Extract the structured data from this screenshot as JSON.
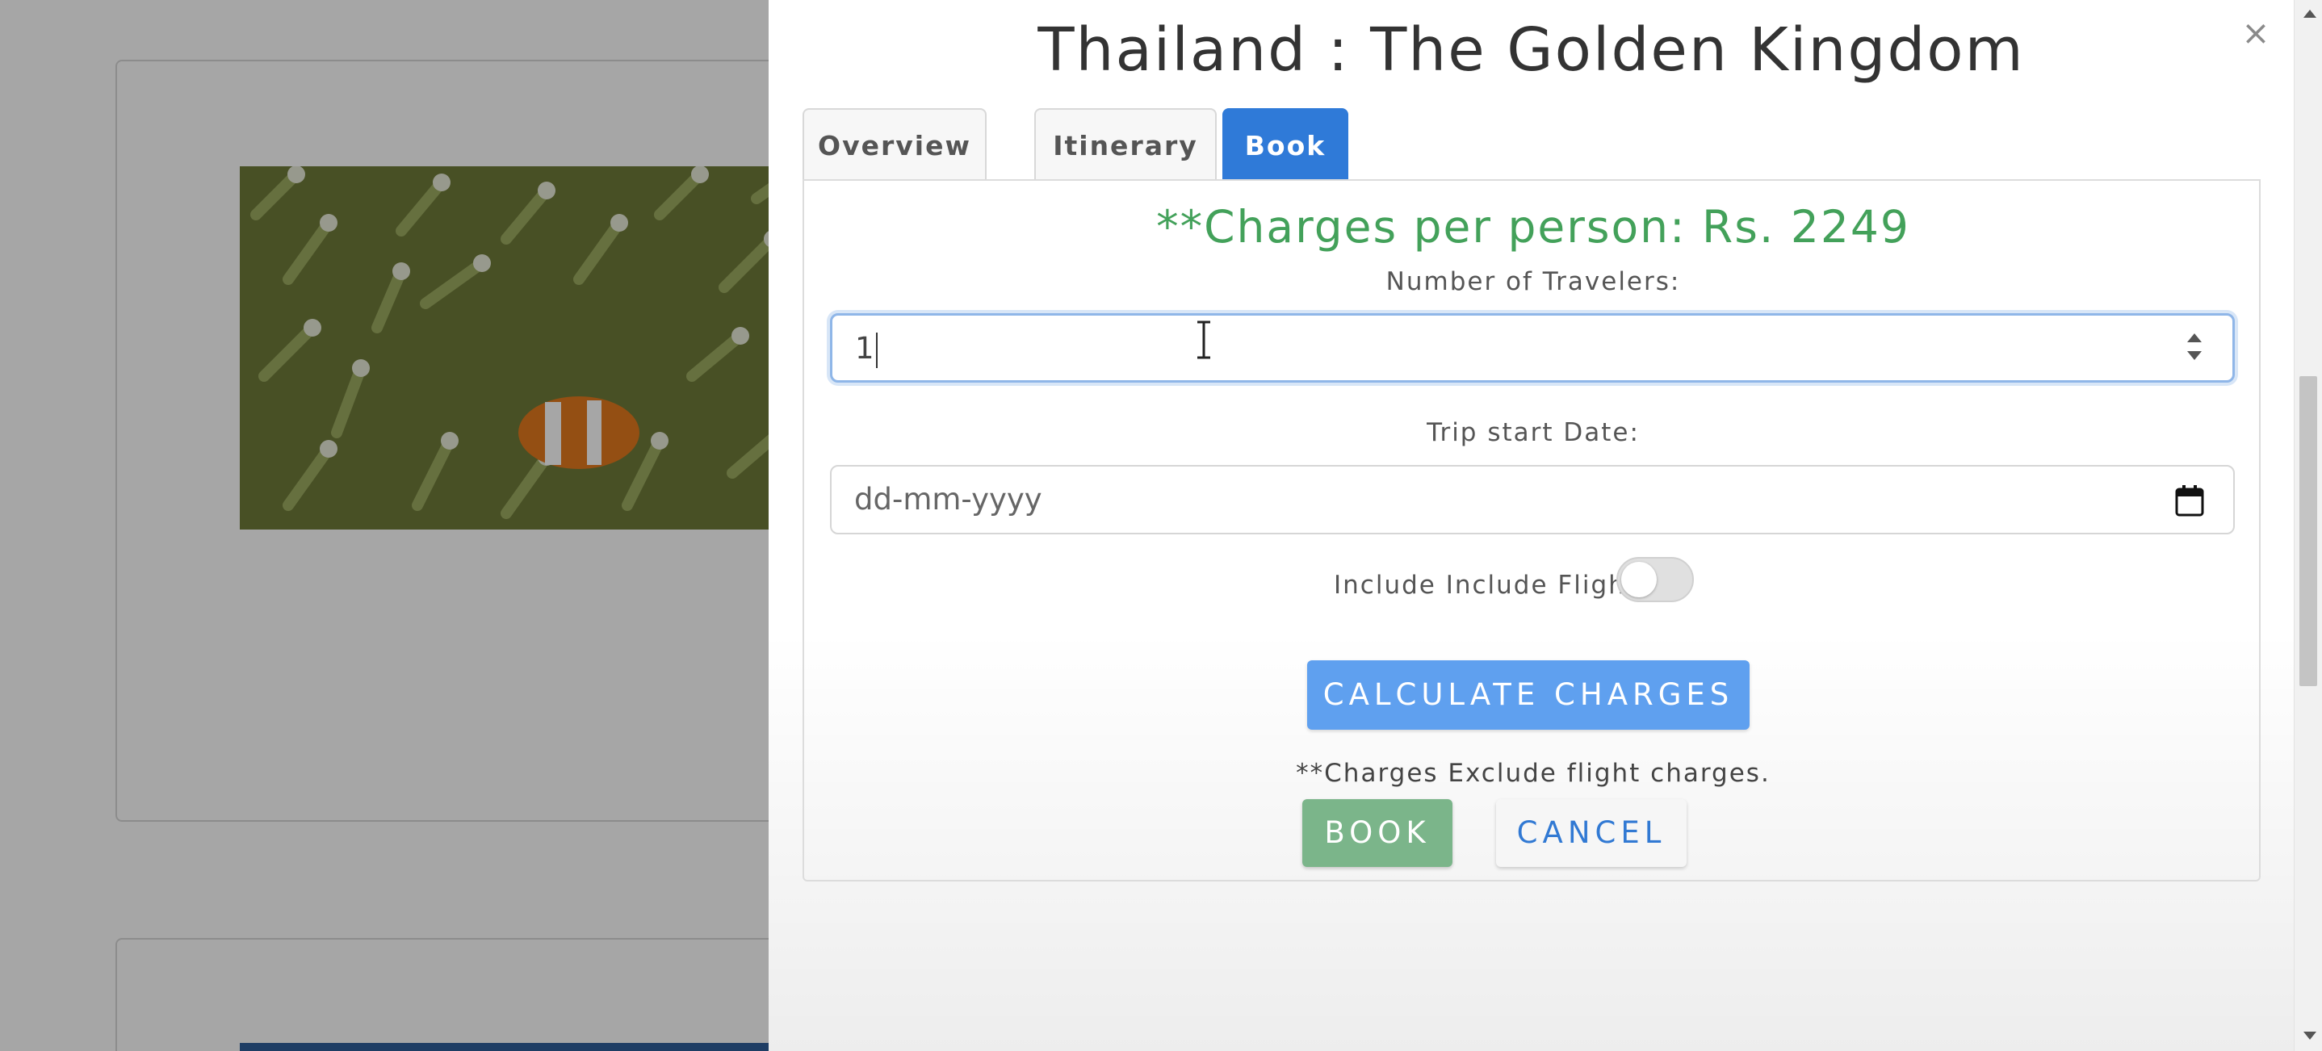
{
  "modal": {
    "title": "Thailand : The Golden Kingdom",
    "close_label": "×",
    "tabs": [
      {
        "label": "Overview",
        "active": false
      },
      {
        "label": "Itinerary",
        "active": false
      },
      {
        "label": "Book",
        "active": true
      }
    ]
  },
  "booking": {
    "charges_text": "**Charges per person: Rs. 2249",
    "travelers_label": "Number of Travelers:",
    "travelers_value": "1",
    "date_label": "Trip start Date:",
    "date_placeholder": "dd-mm-yyyy",
    "flights_label": "Include Include Flights:",
    "flights_included": false,
    "calculate_label": "CALCULATE CHARGES",
    "note": "**Charges Exclude flight charges.",
    "book_label": "BOOK",
    "cancel_label": "CANCEL"
  },
  "icons": {
    "close": "close-icon",
    "calendar": "calendar-icon",
    "spinner": "number-stepper-icon",
    "text_cursor": "text-cursor-icon"
  },
  "colors": {
    "accent_blue": "#2f7ad8",
    "charges_green": "#43a15a",
    "calculate_button": "#5fa0ef",
    "book_button": "#7bb58a",
    "cancel_text": "#3179d3"
  }
}
